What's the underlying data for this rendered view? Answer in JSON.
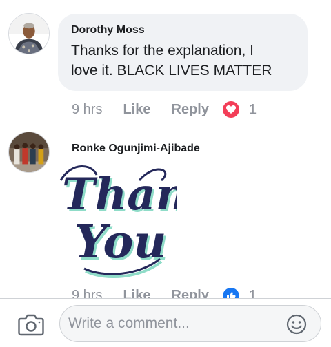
{
  "comments": [
    {
      "author": "Dorothy Moss",
      "text_line1": "Thanks for the explanation, I",
      "text_line2": "love it. BLACK LIVES MATTER",
      "time": "9 hrs",
      "like_label": "Like",
      "reply_label": "Reply",
      "reaction_icon": "love-icon",
      "reaction_count": "1"
    },
    {
      "author": "Ronke Ogunjimi-Ajibade",
      "sticker_line1": "Thank",
      "sticker_line2": "You",
      "time": "9 hrs",
      "like_label": "Like",
      "reply_label": "Reply",
      "reaction_icon": "like-icon",
      "reaction_count": "1"
    }
  ],
  "composer": {
    "placeholder": "Write a comment...",
    "camera_icon": "camera-icon",
    "emoji_icon": "emoji-icon"
  },
  "colors": {
    "bubble": "#f0f2f5",
    "meta_text": "#90949c",
    "love": "#f33e58",
    "like": "#1877f2",
    "sticker_ink": "#24285a",
    "sticker_shadow": "#8fdcc8"
  }
}
